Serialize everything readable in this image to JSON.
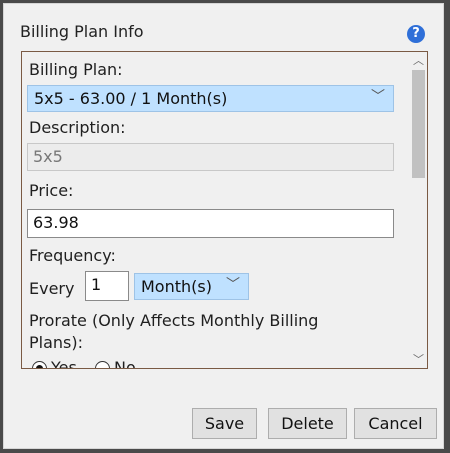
{
  "dialog": {
    "title": "Billing Plan Info",
    "help_icon": "question-circle-icon",
    "help_glyph": "?"
  },
  "form": {
    "billing_plan_label": "Billing Plan:",
    "billing_plan_value": "5x5 - 63.00 / 1 Month(s)",
    "description_label": "Description:",
    "description_value": "5x5",
    "price_label": "Price:",
    "price_value": "63.98",
    "frequency_label": "Frequency:",
    "every_label": "Every",
    "frequency_count": "1",
    "frequency_unit": "Month(s)",
    "prorate_label_line1": "Prorate (Only Affects Monthly Billing",
    "prorate_label_line2": "Plans):",
    "prorate_yes": "Yes",
    "prorate_no": "No"
  },
  "buttons": {
    "save": "Save",
    "delete": "Delete",
    "cancel": "Cancel"
  },
  "colors": {
    "select_background": "#bfe1ff",
    "help_icon": "#2f6fd8",
    "panel_border": "#7a5a44"
  }
}
